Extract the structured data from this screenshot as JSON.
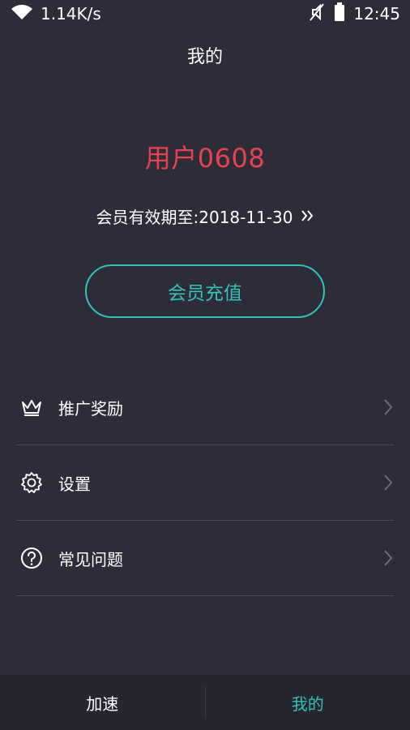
{
  "status_bar": {
    "network_speed": "1.14K/s",
    "time": "12:45",
    "icons": [
      "wifi-icon",
      "mute-icon",
      "battery-icon"
    ]
  },
  "header": {
    "title": "我的"
  },
  "profile": {
    "username": "用户0608",
    "membership_text": "会员有效期至:2018-11-30",
    "recharge_label": "会员充值"
  },
  "menu": {
    "items": [
      {
        "label": "推广奖励",
        "icon": "crown-icon"
      },
      {
        "label": "设置",
        "icon": "gear-icon"
      },
      {
        "label": "常见问题",
        "icon": "help-icon"
      }
    ]
  },
  "bottom_nav": {
    "tabs": [
      {
        "label": "加速",
        "active": false
      },
      {
        "label": "我的",
        "active": true
      }
    ]
  },
  "colors": {
    "background": "#2d2d3a",
    "accent": "#32c3b4",
    "username": "#e8424f",
    "nav_background": "#262631"
  }
}
